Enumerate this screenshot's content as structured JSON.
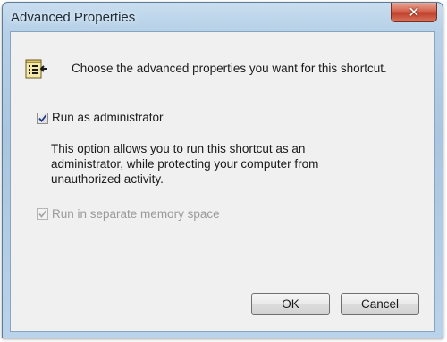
{
  "window": {
    "title": "Advanced Properties",
    "close_icon": "close-icon"
  },
  "header": {
    "icon": "shortcut-properties-icon",
    "text": "Choose the advanced properties you want for this shortcut."
  },
  "options": {
    "run_as_admin": {
      "label": "Run as administrator",
      "checked": true,
      "enabled": true,
      "description_lines": [
        "This option allows you to run this shortcut as an",
        "administrator, while protecting your computer from",
        "unauthorized activity."
      ]
    },
    "separate_memory": {
      "label": "Run in separate memory space",
      "checked": true,
      "enabled": false
    }
  },
  "buttons": {
    "ok": "OK",
    "cancel": "Cancel"
  },
  "colors": {
    "titlebar": "#b7d1e8",
    "close_button": "#c0402b",
    "client_bg": "#f0f0f0",
    "disabled_text": "#9a9a9a"
  }
}
